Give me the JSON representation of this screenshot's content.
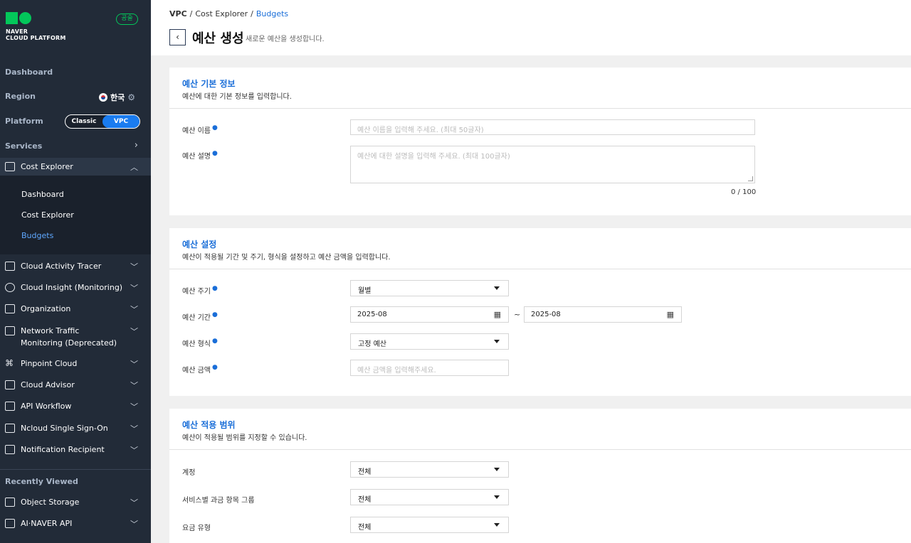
{
  "sidebar": {
    "logo_line1": "NAVER",
    "logo_line2": "CLOUD PLATFORM",
    "gov_badge": "공술",
    "dashboard": "Dashboard",
    "region_label": "Region",
    "region_value": "한국",
    "platform_label": "Platform",
    "platform_options": [
      "Classic",
      "VPC"
    ],
    "platform_selected": "VPC",
    "services_label": "Services",
    "cost_explorer": "Cost Explorer",
    "submenu": [
      "Dashboard",
      "Cost Explorer",
      "Budgets"
    ],
    "submenu_active": "Budgets",
    "menu_items": [
      "Cloud Activity Tracer",
      "Cloud Insight (Monitoring)",
      "Organization",
      "Network Traffic Monitoring (Deprecated)",
      "Pinpoint Cloud",
      "Cloud Advisor",
      "API Workflow",
      "Ncloud Single Sign-On",
      "Notification Recipient"
    ],
    "recently_viewed_label": "Recently Viewed",
    "recent_items": [
      "Object Storage",
      "AI·NAVER API"
    ]
  },
  "breadcrumb": [
    "VPC",
    "Cost Explorer",
    "Budgets"
  ],
  "page": {
    "title": "예산 생성",
    "subtitle": "새로운 예산을 생성합니다."
  },
  "section_basic": {
    "title": "예산 기본 정보",
    "desc": "예산에 대한 기본 정보를 입력합니다.",
    "name_label": "예산 이름",
    "name_placeholder": "예산 이름을 입력해 주세요. (최대 50글자)",
    "desc_label": "예산 설명",
    "desc_placeholder": "예산에 대한 설명을 입력해 주세요. (최대 100글자)",
    "counter": "0 / 100"
  },
  "section_settings": {
    "title": "예산 설정",
    "desc": "예산이 적용될 기간 및 주기, 형식을 설정하고 예산 금액을 입력합니다.",
    "cycle_label": "예산 주기",
    "cycle_value": "월별",
    "period_label": "예산 기간",
    "period_start": "2025-08",
    "period_end": "2025-08",
    "period_sep": "~",
    "type_label": "예산 형식",
    "type_value": "고정 예산",
    "amount_label": "예산 금액",
    "amount_placeholder": "예산 금액을 입력해주세요."
  },
  "section_scope": {
    "title": "예산 적용 범위",
    "desc": "예산이 적용될 범위를 지정할 수 있습니다.",
    "account_label": "계정",
    "account_value": "전체",
    "service_group_label": "서비스별 과금 항목 그룹",
    "service_group_value": "전체",
    "fee_type_label": "요금 유형",
    "fee_type_value": "전체"
  },
  "colors": {
    "sidebar_bg": "#222b38",
    "accent_green": "#03c75a",
    "accent_blue": "#1a6ed8",
    "toggle_active": "#1a7cf0"
  }
}
